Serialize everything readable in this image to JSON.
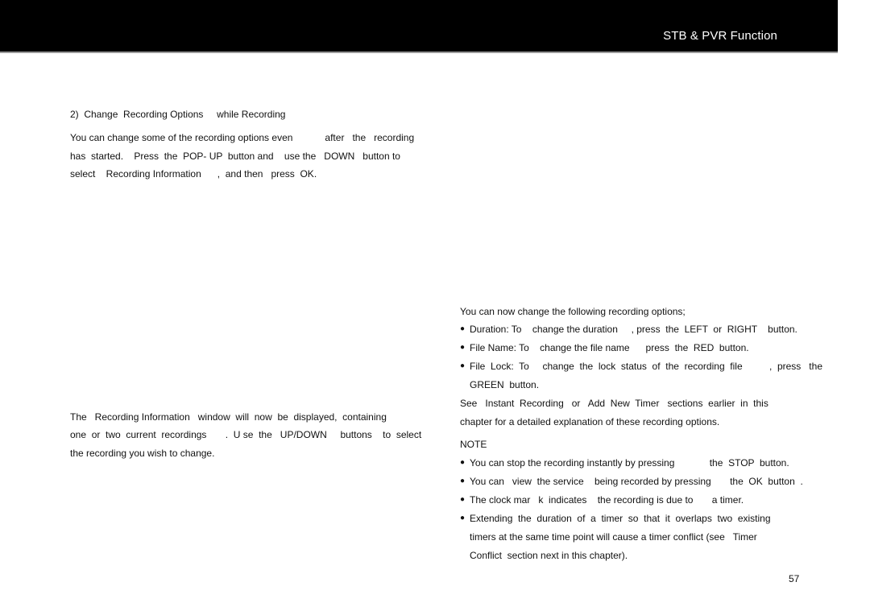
{
  "header": {
    "title": "STB & PVR Function",
    "background_color": "#000000",
    "text_color": "#ffffff"
  },
  "left_column": {
    "section_heading": "2)  Change  Recording Options     while Recording",
    "intro_lines": [
      "You can change some of the recording options even            after   the   recording",
      "has  started.    Press  the  POP- UP  button and    use the   DOWN   button to",
      "select    Recording Information      ,  and then   press  OK."
    ],
    "window_lines": [
      "The   Recording Information   window  will  now  be  displayed,  containing",
      "one  or  two  current  recordings       .  U se  the   UP/DOWN     buttons    to  select",
      "the recording you wish to change."
    ]
  },
  "right_column": {
    "options_intro": "You can now change the following recording options;",
    "options": [
      {
        "lines": [
          "Duration: To    change the duration     , press  the  LEFT  or  RIGHT    button."
        ]
      },
      {
        "lines": [
          "File Name: To    change the file name      press  the  RED  button."
        ]
      },
      {
        "lines": [
          "File  Lock:  To     change  the  lock  status  of  the  recording  file          ,  press   the",
          "GREEN  button."
        ]
      }
    ],
    "see_lines": [
      "See   Instant  Recording   or   Add  New  Timer   sections  earlier  in  this",
      "chapter for a detailed explanation of these recording options."
    ],
    "note_heading": "NOTE",
    "notes": [
      {
        "lines": [
          "You can stop the recording instantly by pressing             the  STOP  button."
        ]
      },
      {
        "lines": [
          "You can   view  the service    being recorded by pressing       the  OK  button  ."
        ]
      },
      {
        "lines": [
          "The clock mar   k  indicates    the recording is due to       a timer."
        ]
      },
      {
        "lines": [
          "Extending  the  duration  of  a  timer  so  that  it  overlaps  two  existing",
          "timers at the same time point will cause a timer conflict (see   Timer",
          "Conflict  section next in this chapter)."
        ]
      }
    ]
  },
  "footer": {
    "page_number": "57"
  }
}
